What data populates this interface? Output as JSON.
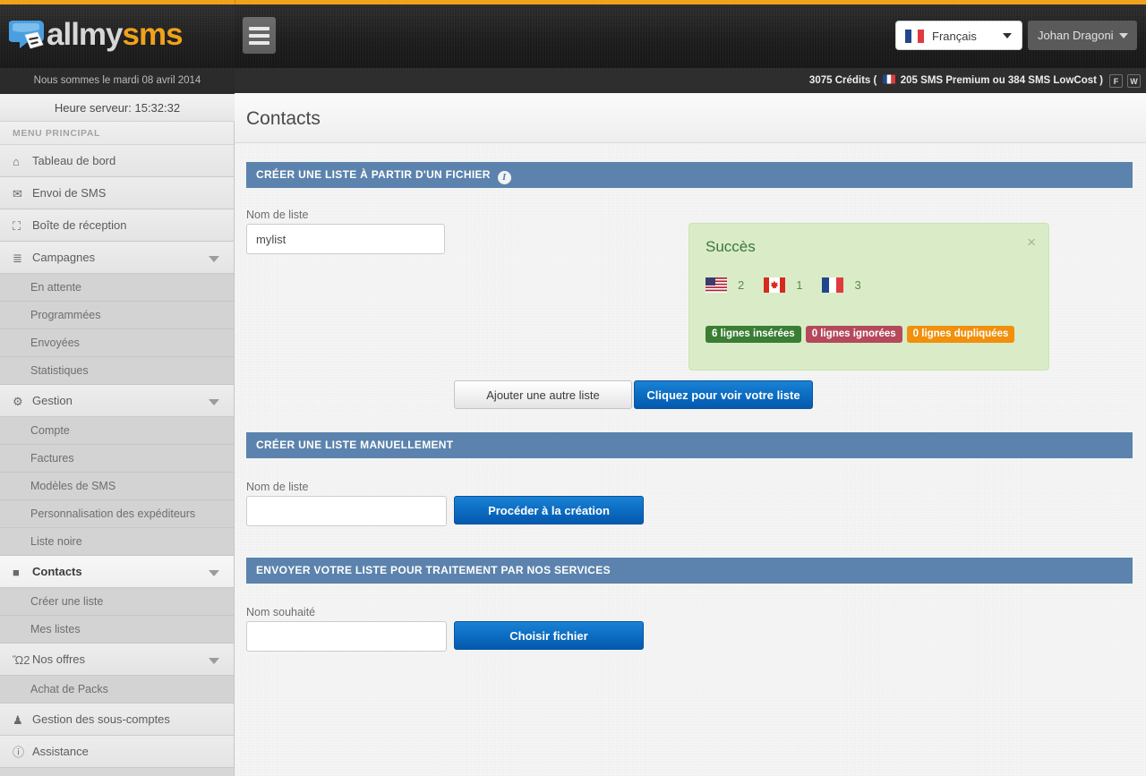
{
  "brand": {
    "part1": "all",
    "part2": "my",
    "part3": "sms",
    "logo_icon": "speech-bubble-logo"
  },
  "header": {
    "hamburger_icon": "hamburger-menu-icon",
    "language": {
      "label": "Français",
      "flag": "fr-flag-icon",
      "caret_icon": "chevron-down-icon"
    },
    "user": {
      "name": "Johan Dragoni",
      "caret_icon": "chevron-down-icon"
    }
  },
  "credits": {
    "prefix": "3075 Crédits (",
    "flag": "fr-flag-icon",
    "detail": "205 SMS Premium ou 384 SMS LowCost )",
    "buttons": [
      {
        "label": "F",
        "name": "facebook-button"
      },
      {
        "label": "W",
        "name": "twitter-button"
      }
    ]
  },
  "sidebar": {
    "date_line": "Nous sommes le mardi 08 avril 2014",
    "server_time": "Heure serveur: 15:32:32",
    "menu_title": "MENU PRINCIPAL",
    "items": [
      {
        "label": "Tableau de bord",
        "icon": "home-icon",
        "glyph": "⌂",
        "type": "item",
        "name": "sidebar-item-tableau-de-bord",
        "active": false,
        "caret": false
      },
      {
        "label": "Envoi de SMS",
        "icon": "envelope-icon",
        "glyph": "✉",
        "type": "item",
        "name": "sidebar-item-envoi-de-sms",
        "active": false,
        "caret": false
      },
      {
        "label": "Boîte de réception",
        "icon": "inbox-icon",
        "glyph": "⛶",
        "type": "item",
        "name": "sidebar-item-boite-de-reception",
        "active": false,
        "caret": false
      },
      {
        "label": "Campagnes",
        "icon": "list-icon",
        "glyph": "≣",
        "type": "item",
        "name": "sidebar-item-campagnes",
        "active": false,
        "caret": true
      },
      {
        "label": "En attente",
        "type": "sub",
        "name": "sidebar-subitem-en-attente"
      },
      {
        "label": "Programmées",
        "type": "sub",
        "name": "sidebar-subitem-programmees"
      },
      {
        "label": "Envoyées",
        "type": "sub",
        "name": "sidebar-subitem-envoyees"
      },
      {
        "label": "Statistiques",
        "type": "sub",
        "name": "sidebar-subitem-statistiques"
      },
      {
        "label": "Gestion",
        "icon": "gear-icon",
        "glyph": "⚙",
        "type": "item",
        "name": "sidebar-item-gestion",
        "active": false,
        "caret": true
      },
      {
        "label": "Compte",
        "type": "sub",
        "name": "sidebar-subitem-compte"
      },
      {
        "label": "Factures",
        "type": "sub",
        "name": "sidebar-subitem-factures"
      },
      {
        "label": "Modèles de SMS",
        "type": "sub",
        "name": "sidebar-subitem-modeles-de-sms"
      },
      {
        "label": "Personnalisation des expéditeurs",
        "type": "sub",
        "name": "sidebar-subitem-personnalisation-des-expediteurs"
      },
      {
        "label": "Liste noire",
        "type": "sub",
        "name": "sidebar-subitem-liste-noire"
      },
      {
        "label": "Contacts",
        "icon": "book-icon",
        "glyph": "■",
        "type": "item",
        "name": "sidebar-item-contacts",
        "active": true,
        "caret": true
      },
      {
        "label": "Créer une liste",
        "type": "sub",
        "name": "sidebar-subitem-creer-une-liste"
      },
      {
        "label": "Mes listes",
        "type": "sub",
        "name": "sidebar-subitem-mes-listes"
      },
      {
        "label": "Nos offres",
        "icon": "cart-icon",
        "glyph": "Ὥ2",
        "type": "item",
        "name": "sidebar-item-nos-offres",
        "active": false,
        "caret": true
      },
      {
        "label": "Achat de Packs",
        "type": "sub",
        "name": "sidebar-subitem-achat-de-packs"
      },
      {
        "label": "Gestion des sous-comptes",
        "icon": "user-icon",
        "glyph": "♟",
        "type": "item",
        "name": "sidebar-item-gestion-des-sous-comptes",
        "active": false,
        "caret": false
      },
      {
        "label": "Assistance",
        "icon": "info-circle-icon",
        "glyph": "ⓘ",
        "type": "item",
        "name": "sidebar-item-assistance",
        "active": false,
        "caret": false
      }
    ]
  },
  "page": {
    "title": "Contacts"
  },
  "section_file": {
    "header": "Créer une liste à partir d'un fichier",
    "info_icon": "info-icon",
    "name_label": "Nom de liste",
    "name_value": "mylist",
    "name_placeholder": "",
    "add_another_label": "Ajouter une autre liste",
    "view_list_label": "Cliquez pour voir votre liste"
  },
  "success": {
    "title": "Succès",
    "close_icon": "close-icon",
    "flags": [
      {
        "country": "us",
        "icon": "us-flag-icon",
        "count": "2"
      },
      {
        "country": "ca",
        "icon": "ca-flag-icon",
        "count": "1"
      },
      {
        "country": "fr",
        "icon": "fr-flag-icon",
        "count": "3"
      }
    ],
    "badges": [
      {
        "label": "6 lignes insérées",
        "color": "#3a7d34",
        "name": "badge-inserted"
      },
      {
        "label": "0 lignes ignorées",
        "color": "#b5495b",
        "name": "badge-ignored"
      },
      {
        "label": "0 lignes dupliquées",
        "color": "#f0900c",
        "name": "badge-duplicated"
      }
    ]
  },
  "section_manual": {
    "header": "Créer une liste manuellement",
    "name_label": "Nom de liste",
    "name_value": "",
    "name_placeholder": "",
    "button_label": "Procéder à la création"
  },
  "section_service": {
    "header": "Envoyer votre liste pour traitement par nos services",
    "name_label": "Nom souhaité",
    "name_value": "",
    "name_placeholder": "",
    "button_label": "Choisir fichier"
  },
  "colors": {
    "accent_orange": "#f0a21b",
    "panel_blue": "#5b83ad",
    "button_blue": "#0d6fc4",
    "success_bg": "#d9ecc7",
    "success_text": "#3c763d"
  }
}
